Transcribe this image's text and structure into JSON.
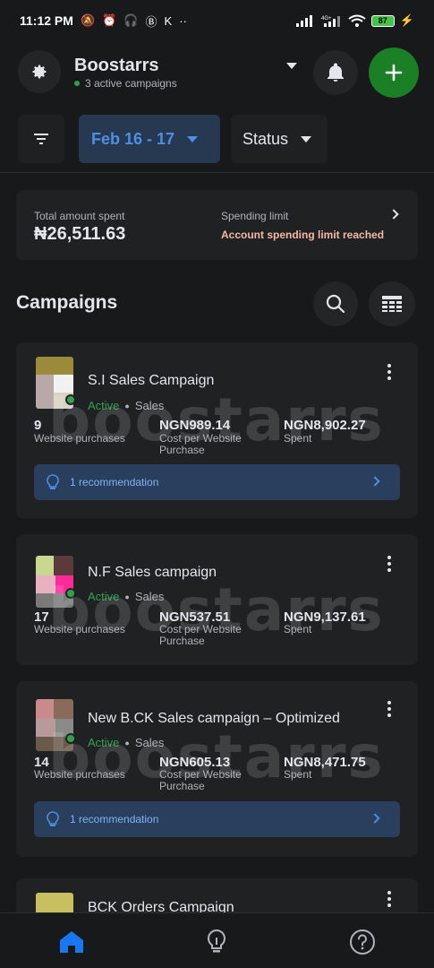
{
  "status_bar": {
    "time": "11:12 PM",
    "battery": "87"
  },
  "header": {
    "account_name": "Boostarrs",
    "account_sub": "3 active campaigns"
  },
  "filters": {
    "date_range": "Feb 16 - 17",
    "status_label": "Status"
  },
  "summary": {
    "total_label": "Total amount spent",
    "total_value": "₦26,511.63",
    "limit_label": "Spending limit",
    "limit_warning": "Account spending limit reached"
  },
  "campaigns": {
    "title": "Campaigns",
    "items": [
      {
        "name": "S.I Sales Campaign",
        "status": "Active",
        "objective": "Sales",
        "results": "9",
        "results_label": "Website purchases",
        "cost": "NGN989.14",
        "cost_label": "Cost per Website Purchase",
        "spent": "NGN8,902.27",
        "spent_label": "Spent",
        "recommendation": "1 recommendation"
      },
      {
        "name": "N.F Sales campaign",
        "status": "Active",
        "objective": "Sales",
        "results": "17",
        "results_label": "Website purchases",
        "cost": "NGN537.51",
        "cost_label": "Cost per Website Purchase",
        "spent": "NGN9,137.61",
        "spent_label": "Spent"
      },
      {
        "name": "New B.CK Sales campaign – Optimized",
        "status": "Active",
        "objective": "Sales",
        "results": "14",
        "results_label": "Website purchases",
        "cost": "NGN605.13",
        "cost_label": "Cost per Website Purchase",
        "spent": "NGN8,471.75",
        "spent_label": "Spent",
        "recommendation": "1 recommendation"
      },
      {
        "name": "BCK Orders Campaign"
      }
    ]
  },
  "watermark": "boostarrs",
  "colors": {
    "background": "#18191b",
    "card": "#202123",
    "accent_green": "#1a7f25",
    "active_green": "#31a24c",
    "link_blue": "#4d8fe6",
    "warning": "#f5b8a6"
  },
  "icons": [
    "settings-icon",
    "bell-icon",
    "plus-icon",
    "filter-icon",
    "search-icon",
    "table-icon",
    "lightbulb-icon",
    "home-icon",
    "help-icon"
  ]
}
